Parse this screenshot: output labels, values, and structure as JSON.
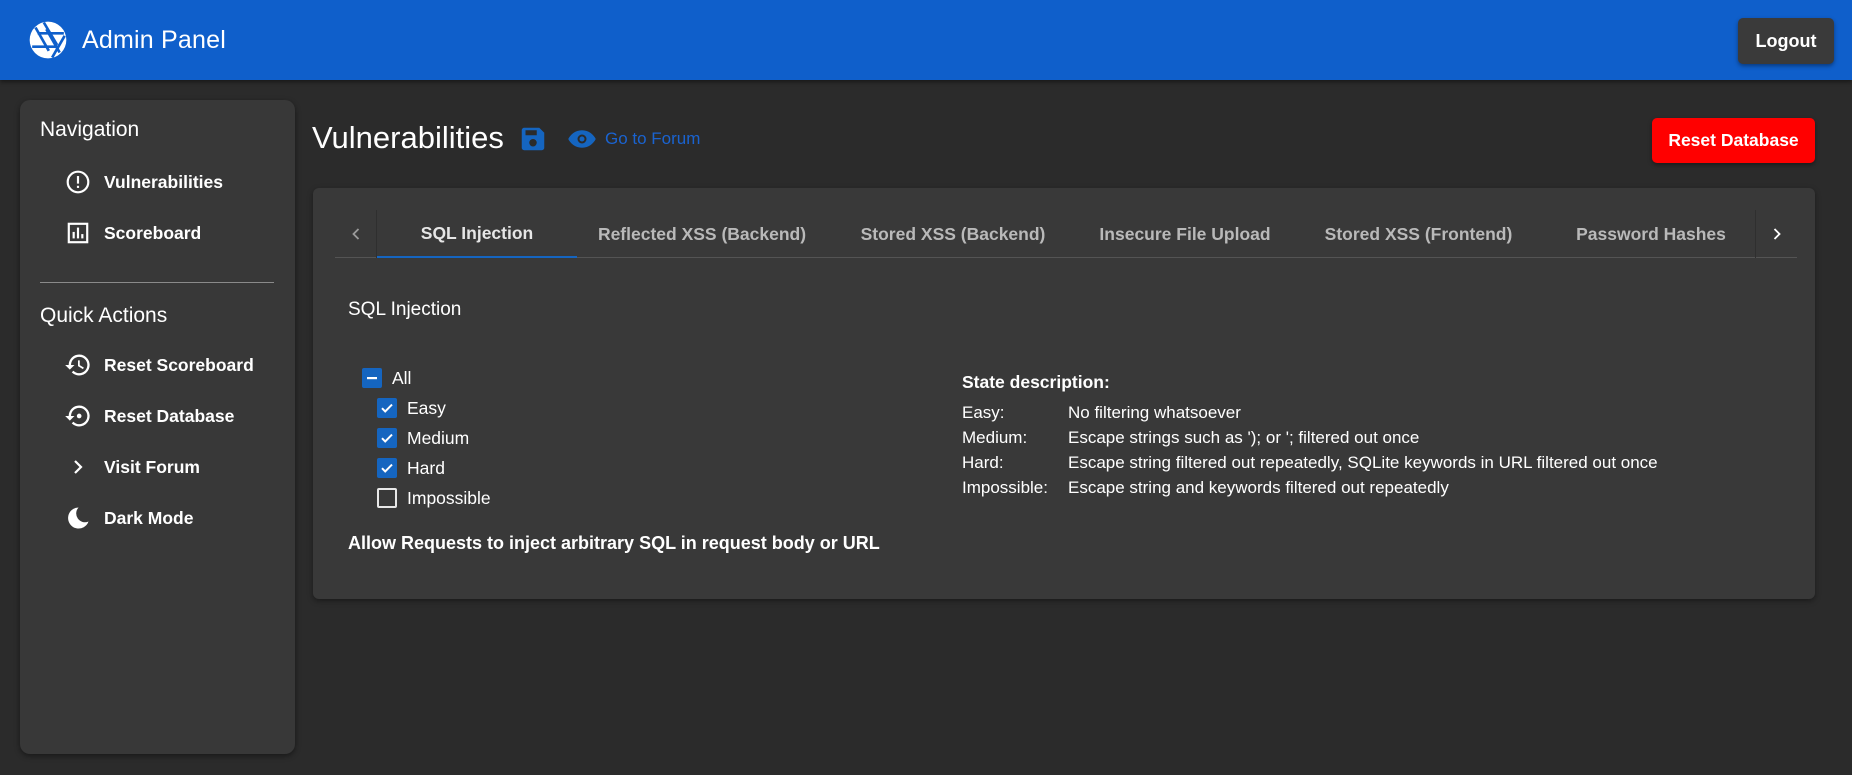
{
  "appbar": {
    "title": "Admin Panel",
    "logo_icon": "aperture-icon",
    "logout_label": "Logout",
    "color": "#0f5fcb"
  },
  "sidebar": {
    "navigation_heading": "Navigation",
    "navigation_items": [
      {
        "label": "Vulnerabilities",
        "icon": "alert-circle-icon"
      },
      {
        "label": "Scoreboard",
        "icon": "bar-chart-icon"
      }
    ],
    "quick_actions_heading": "Quick Actions",
    "quick_action_items": [
      {
        "label": "Reset Scoreboard",
        "icon": "history-icon"
      },
      {
        "label": "Reset Database",
        "icon": "restore-icon"
      },
      {
        "label": "Visit Forum",
        "icon": "chevron-right-icon"
      },
      {
        "label": "Dark Mode",
        "icon": "moon-icon"
      }
    ]
  },
  "header": {
    "title": "Vulnerabilities",
    "save_icon": "save-icon",
    "forum_link_label": "Go to Forum",
    "forum_link_icon": "eye-icon",
    "reset_database_label": "Reset Database",
    "reset_color": "#ff0000",
    "accent_color": "#1565c0"
  },
  "tabs": [
    {
      "label": "SQL Injection",
      "active": true
    },
    {
      "label": "Reflected XSS (Backend)",
      "active": false
    },
    {
      "label": "Stored XSS (Backend)",
      "active": false
    },
    {
      "label": "Insecure File Upload",
      "active": false
    },
    {
      "label": "Stored XSS (Frontend)",
      "active": false
    },
    {
      "label": "Password Hashes",
      "active": false
    }
  ],
  "panel": {
    "section_title": "SQL Injection",
    "checkboxes": [
      {
        "label": "All",
        "state": "indeterminate"
      },
      {
        "label": "Easy",
        "state": "checked"
      },
      {
        "label": "Medium",
        "state": "checked"
      },
      {
        "label": "Hard",
        "state": "checked"
      },
      {
        "label": "Impossible",
        "state": "unchecked"
      }
    ],
    "description": "Allow Requests to inject arbitrary SQL in request body or URL",
    "state_description_title": "State description:",
    "states": [
      {
        "level": "Easy:",
        "text": "No filtering whatsoever"
      },
      {
        "level": "Medium:",
        "text": "Escape strings such as '); or '; filtered out once"
      },
      {
        "level": "Hard:",
        "text": "Escape string filtered out repeatedly, SQLite keywords in URL filtered out once"
      },
      {
        "level": "Impossible:",
        "text": "Escape string and keywords filtered out repeatedly"
      }
    ]
  }
}
